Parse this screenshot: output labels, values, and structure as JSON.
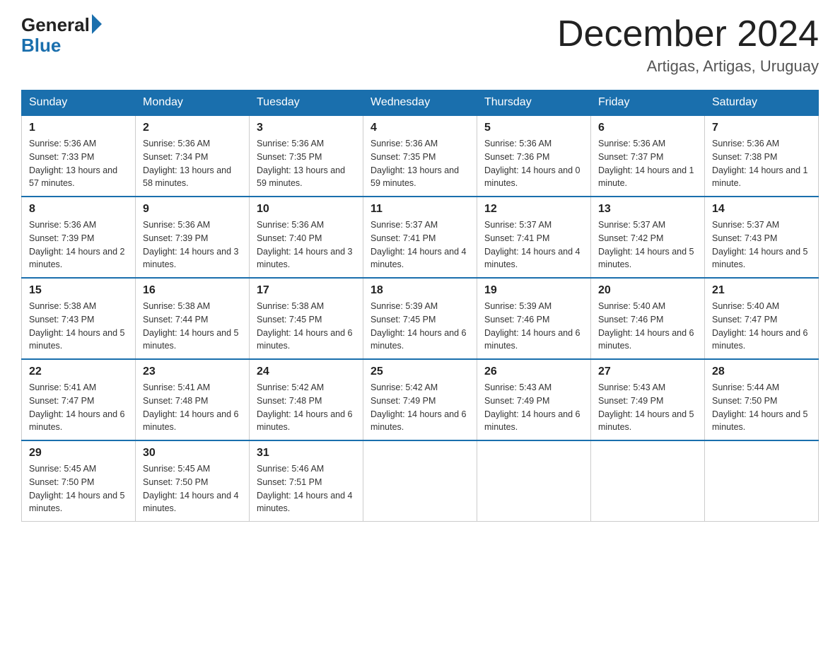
{
  "header": {
    "logo_general": "General",
    "logo_blue": "Blue",
    "month_title": "December 2024",
    "location": "Artigas, Artigas, Uruguay"
  },
  "weekdays": [
    "Sunday",
    "Monday",
    "Tuesday",
    "Wednesday",
    "Thursday",
    "Friday",
    "Saturday"
  ],
  "weeks": [
    [
      {
        "day": "1",
        "sunrise": "5:36 AM",
        "sunset": "7:33 PM",
        "daylight": "13 hours and 57 minutes."
      },
      {
        "day": "2",
        "sunrise": "5:36 AM",
        "sunset": "7:34 PM",
        "daylight": "13 hours and 58 minutes."
      },
      {
        "day": "3",
        "sunrise": "5:36 AM",
        "sunset": "7:35 PM",
        "daylight": "13 hours and 59 minutes."
      },
      {
        "day": "4",
        "sunrise": "5:36 AM",
        "sunset": "7:35 PM",
        "daylight": "13 hours and 59 minutes."
      },
      {
        "day": "5",
        "sunrise": "5:36 AM",
        "sunset": "7:36 PM",
        "daylight": "14 hours and 0 minutes."
      },
      {
        "day": "6",
        "sunrise": "5:36 AM",
        "sunset": "7:37 PM",
        "daylight": "14 hours and 1 minute."
      },
      {
        "day": "7",
        "sunrise": "5:36 AM",
        "sunset": "7:38 PM",
        "daylight": "14 hours and 1 minute."
      }
    ],
    [
      {
        "day": "8",
        "sunrise": "5:36 AM",
        "sunset": "7:39 PM",
        "daylight": "14 hours and 2 minutes."
      },
      {
        "day": "9",
        "sunrise": "5:36 AM",
        "sunset": "7:39 PM",
        "daylight": "14 hours and 3 minutes."
      },
      {
        "day": "10",
        "sunrise": "5:36 AM",
        "sunset": "7:40 PM",
        "daylight": "14 hours and 3 minutes."
      },
      {
        "day": "11",
        "sunrise": "5:37 AM",
        "sunset": "7:41 PM",
        "daylight": "14 hours and 4 minutes."
      },
      {
        "day": "12",
        "sunrise": "5:37 AM",
        "sunset": "7:41 PM",
        "daylight": "14 hours and 4 minutes."
      },
      {
        "day": "13",
        "sunrise": "5:37 AM",
        "sunset": "7:42 PM",
        "daylight": "14 hours and 5 minutes."
      },
      {
        "day": "14",
        "sunrise": "5:37 AM",
        "sunset": "7:43 PM",
        "daylight": "14 hours and 5 minutes."
      }
    ],
    [
      {
        "day": "15",
        "sunrise": "5:38 AM",
        "sunset": "7:43 PM",
        "daylight": "14 hours and 5 minutes."
      },
      {
        "day": "16",
        "sunrise": "5:38 AM",
        "sunset": "7:44 PM",
        "daylight": "14 hours and 5 minutes."
      },
      {
        "day": "17",
        "sunrise": "5:38 AM",
        "sunset": "7:45 PM",
        "daylight": "14 hours and 6 minutes."
      },
      {
        "day": "18",
        "sunrise": "5:39 AM",
        "sunset": "7:45 PM",
        "daylight": "14 hours and 6 minutes."
      },
      {
        "day": "19",
        "sunrise": "5:39 AM",
        "sunset": "7:46 PM",
        "daylight": "14 hours and 6 minutes."
      },
      {
        "day": "20",
        "sunrise": "5:40 AM",
        "sunset": "7:46 PM",
        "daylight": "14 hours and 6 minutes."
      },
      {
        "day": "21",
        "sunrise": "5:40 AM",
        "sunset": "7:47 PM",
        "daylight": "14 hours and 6 minutes."
      }
    ],
    [
      {
        "day": "22",
        "sunrise": "5:41 AM",
        "sunset": "7:47 PM",
        "daylight": "14 hours and 6 minutes."
      },
      {
        "day": "23",
        "sunrise": "5:41 AM",
        "sunset": "7:48 PM",
        "daylight": "14 hours and 6 minutes."
      },
      {
        "day": "24",
        "sunrise": "5:42 AM",
        "sunset": "7:48 PM",
        "daylight": "14 hours and 6 minutes."
      },
      {
        "day": "25",
        "sunrise": "5:42 AM",
        "sunset": "7:49 PM",
        "daylight": "14 hours and 6 minutes."
      },
      {
        "day": "26",
        "sunrise": "5:43 AM",
        "sunset": "7:49 PM",
        "daylight": "14 hours and 6 minutes."
      },
      {
        "day": "27",
        "sunrise": "5:43 AM",
        "sunset": "7:49 PM",
        "daylight": "14 hours and 5 minutes."
      },
      {
        "day": "28",
        "sunrise": "5:44 AM",
        "sunset": "7:50 PM",
        "daylight": "14 hours and 5 minutes."
      }
    ],
    [
      {
        "day": "29",
        "sunrise": "5:45 AM",
        "sunset": "7:50 PM",
        "daylight": "14 hours and 5 minutes."
      },
      {
        "day": "30",
        "sunrise": "5:45 AM",
        "sunset": "7:50 PM",
        "daylight": "14 hours and 4 minutes."
      },
      {
        "day": "31",
        "sunrise": "5:46 AM",
        "sunset": "7:51 PM",
        "daylight": "14 hours and 4 minutes."
      },
      null,
      null,
      null,
      null
    ]
  ]
}
